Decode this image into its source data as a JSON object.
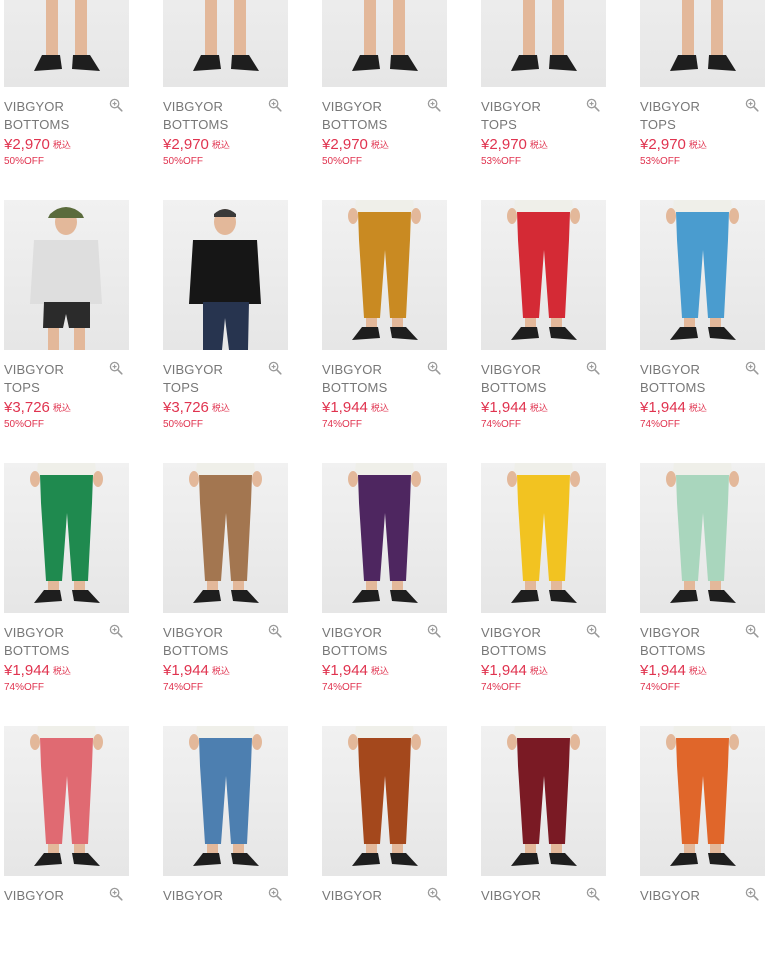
{
  "products": [
    {
      "brand": "VIBGYOR",
      "category": "BOTTOMS",
      "price": "¥2,970",
      "tax": "税込",
      "discount": "50%OFF",
      "garment": "shorts",
      "color": "#7a2a33",
      "top": "#ffffff"
    },
    {
      "brand": "VIBGYOR",
      "category": "BOTTOMS",
      "price": "¥2,970",
      "tax": "税込",
      "discount": "50%OFF",
      "garment": "shorts",
      "color": "#d9a43a",
      "top": "#ffffff"
    },
    {
      "brand": "VIBGYOR",
      "category": "BOTTOMS",
      "price": "¥2,970",
      "tax": "税込",
      "discount": "50%OFF",
      "garment": "shorts",
      "color": "#3a3ccf",
      "top": "#ffffff"
    },
    {
      "brand": "VIBGYOR",
      "category": "TOPS",
      "price": "¥2,970",
      "tax": "税込",
      "discount": "53%OFF",
      "garment": "shorts",
      "color": "#2b2b2b",
      "top": "#dadada"
    },
    {
      "brand": "VIBGYOR",
      "category": "TOPS",
      "price": "¥2,970",
      "tax": "税込",
      "discount": "53%OFF",
      "garment": "shorts",
      "color": "#2b2b2b",
      "top": "#161616"
    },
    {
      "brand": "VIBGYOR",
      "category": "TOPS",
      "price": "¥3,726",
      "tax": "税込",
      "discount": "50%OFF",
      "garment": "hoodie-shorts",
      "color": "#2b2b2b",
      "top": "#dedede"
    },
    {
      "brand": "VIBGYOR",
      "category": "TOPS",
      "price": "¥3,726",
      "tax": "税込",
      "discount": "50%OFF",
      "garment": "hoodie-jeans",
      "color": "#27344f",
      "top": "#161616"
    },
    {
      "brand": "VIBGYOR",
      "category": "BOTTOMS",
      "price": "¥1,944",
      "tax": "税込",
      "discount": "74%OFF",
      "garment": "pants",
      "color": "#c98a22",
      "top": "#efefe9"
    },
    {
      "brand": "VIBGYOR",
      "category": "BOTTOMS",
      "price": "¥1,944",
      "tax": "税込",
      "discount": "74%OFF",
      "garment": "pants",
      "color": "#d42a35",
      "top": "#efefe9"
    },
    {
      "brand": "VIBGYOR",
      "category": "BOTTOMS",
      "price": "¥1,944",
      "tax": "税込",
      "discount": "74%OFF",
      "garment": "pants",
      "color": "#4a9ccf",
      "top": "#efefe9"
    },
    {
      "brand": "VIBGYOR",
      "category": "BOTTOMS",
      "price": "¥1,944",
      "tax": "税込",
      "discount": "74%OFF",
      "garment": "pants",
      "color": "#1f8a4f",
      "top": "#efefe9"
    },
    {
      "brand": "VIBGYOR",
      "category": "BOTTOMS",
      "price": "¥1,944",
      "tax": "税込",
      "discount": "74%OFF",
      "garment": "pants",
      "color": "#a37650",
      "top": "#efefe9"
    },
    {
      "brand": "VIBGYOR",
      "category": "BOTTOMS",
      "price": "¥1,944",
      "tax": "税込",
      "discount": "74%OFF",
      "garment": "pants",
      "color": "#4e2660",
      "top": "#efefe9"
    },
    {
      "brand": "VIBGYOR",
      "category": "BOTTOMS",
      "price": "¥1,944",
      "tax": "税込",
      "discount": "74%OFF",
      "garment": "pants",
      "color": "#f2c321",
      "top": "#efefe9"
    },
    {
      "brand": "VIBGYOR",
      "category": "BOTTOMS",
      "price": "¥1,944",
      "tax": "税込",
      "discount": "74%OFF",
      "garment": "pants",
      "color": "#a9d6bd",
      "top": "#efefe9"
    },
    {
      "brand": "VIBGYOR",
      "category": "",
      "price": "",
      "tax": "",
      "discount": "",
      "garment": "pants",
      "color": "#e06a72",
      "top": "#efefe9"
    },
    {
      "brand": "VIBGYOR",
      "category": "",
      "price": "",
      "tax": "",
      "discount": "",
      "garment": "pants",
      "color": "#4d7fb0",
      "top": "#efefe9"
    },
    {
      "brand": "VIBGYOR",
      "category": "",
      "price": "",
      "tax": "",
      "discount": "",
      "garment": "pants",
      "color": "#a4481c",
      "top": "#efefe9"
    },
    {
      "brand": "VIBGYOR",
      "category": "",
      "price": "",
      "tax": "",
      "discount": "",
      "garment": "pants",
      "color": "#7a1a24",
      "top": "#efefe9"
    },
    {
      "brand": "VIBGYOR",
      "category": "",
      "price": "",
      "tax": "",
      "discount": "",
      "garment": "pants",
      "color": "#e0662a",
      "top": "#efefe9"
    }
  ]
}
